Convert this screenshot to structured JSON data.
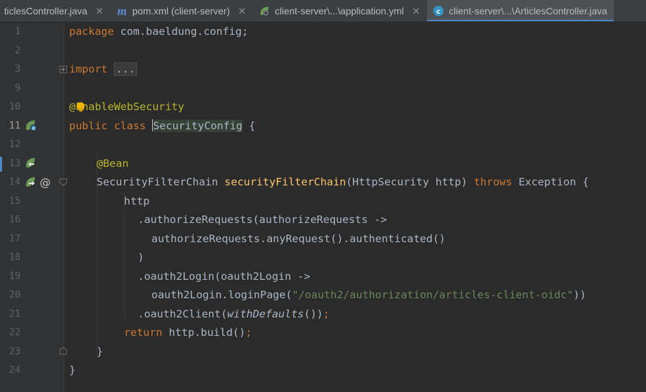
{
  "tabs": [
    {
      "label": "ticlesController.java",
      "icon": "java-class-icon",
      "active": false
    },
    {
      "label": "pom.xml (client-server)",
      "icon": "maven-icon",
      "active": false
    },
    {
      "label": "client-server\\...\\application.yml",
      "icon": "spring-yml-icon",
      "active": false
    },
    {
      "label": "client-server\\...\\ArticlesController.java",
      "icon": "java-class-icon",
      "active": true
    }
  ],
  "colors": {
    "keyword": "#cc7832",
    "annotation": "#bbb529",
    "method": "#ffc66d",
    "string": "#6a8759",
    "text": "#a9b7c6",
    "background": "#2b2b2b"
  },
  "code": {
    "line1": {
      "no": "1",
      "kw": "package",
      "rest": " com.baeldung.config;"
    },
    "line2": {
      "no": "2"
    },
    "line3": {
      "no": "3",
      "kw": "import",
      "sp": " ",
      "fold": "..."
    },
    "line9": {
      "no": "9"
    },
    "line10": {
      "no": "10",
      "ann": "@EnableWebSecurity"
    },
    "line11": {
      "no": "11",
      "kw1": "public",
      "kw2": "class",
      "cls": "SecurityConfig",
      "rest": " {"
    },
    "line12": {
      "no": "12"
    },
    "line13": {
      "no": "13",
      "ann": "@Bean"
    },
    "line14": {
      "no": "14",
      "type": "SecurityFilterChain",
      "method": "securityFilterChain",
      "params": "(HttpSecurity http) ",
      "kw": "throws",
      "rest": " Exception {"
    },
    "line15": {
      "no": "15",
      "text": "http"
    },
    "line16": {
      "no": "16",
      "text": ".authorizeRequests(authorizeRequests ->"
    },
    "line17": {
      "no": "17",
      "text": "authorizeRequests.anyRequest().authenticated()"
    },
    "line18": {
      "no": "18",
      "text": ")"
    },
    "line19": {
      "no": "19",
      "text": ".oauth2Login(oauth2Login ->"
    },
    "line20": {
      "no": "20",
      "pre": "oauth2Login.loginPage(",
      "str": "\"/oauth2/authorization/articles-client-oidc\"",
      "post": "))"
    },
    "line21": {
      "no": "21",
      "pre": ".oauth2Client(",
      "it": "withDefaults",
      "post": "())",
      "semi": ";"
    },
    "line22": {
      "no": "22",
      "kw": "return",
      "rest": " http.build()",
      "semi": ";"
    },
    "line23": {
      "no": "23",
      "text": "}"
    },
    "line24": {
      "no": "24",
      "text": "}"
    }
  },
  "gutter": {
    "override_marker": "@"
  }
}
